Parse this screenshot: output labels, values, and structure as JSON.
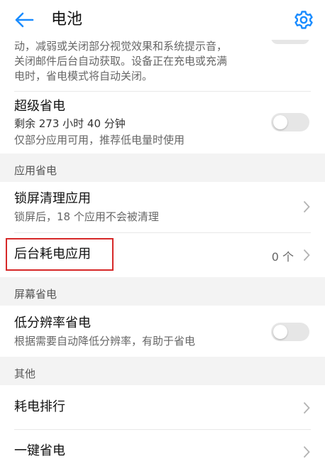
{
  "header": {
    "title": "电池",
    "back_icon": "arrow-left-icon",
    "settings_icon": "gear-icon",
    "accent": "#1a8cff"
  },
  "power_saving_desc": {
    "lines": [
      "动，减弱或关闭部分视觉效果和系统提示音，",
      "关闭邮件后台自动获取。设备正在充电或充满",
      "电时，省电模式将自动关闭。"
    ]
  },
  "ultra_saving": {
    "title": "超级省电",
    "remaining": "剩余 273 小时 40 分钟",
    "desc": "仅部分应用可用，推荐低电量时使用",
    "enabled": false
  },
  "sections": {
    "app_saving": "应用省电",
    "screen_saving": "屏幕省电",
    "other": "其他"
  },
  "lock_screen_clean": {
    "title": "锁屏清理应用",
    "desc": "锁屏后，18 个应用不会被清理"
  },
  "background_apps": {
    "title": "后台耗电应用",
    "value": "0 个"
  },
  "low_resolution": {
    "title": "低分辨率省电",
    "desc": "根据需要自动降低分辨率，有助于省电",
    "enabled": false
  },
  "power_ranking": {
    "title": "耗电排行"
  },
  "one_key_saving": {
    "title": "一键省电"
  }
}
